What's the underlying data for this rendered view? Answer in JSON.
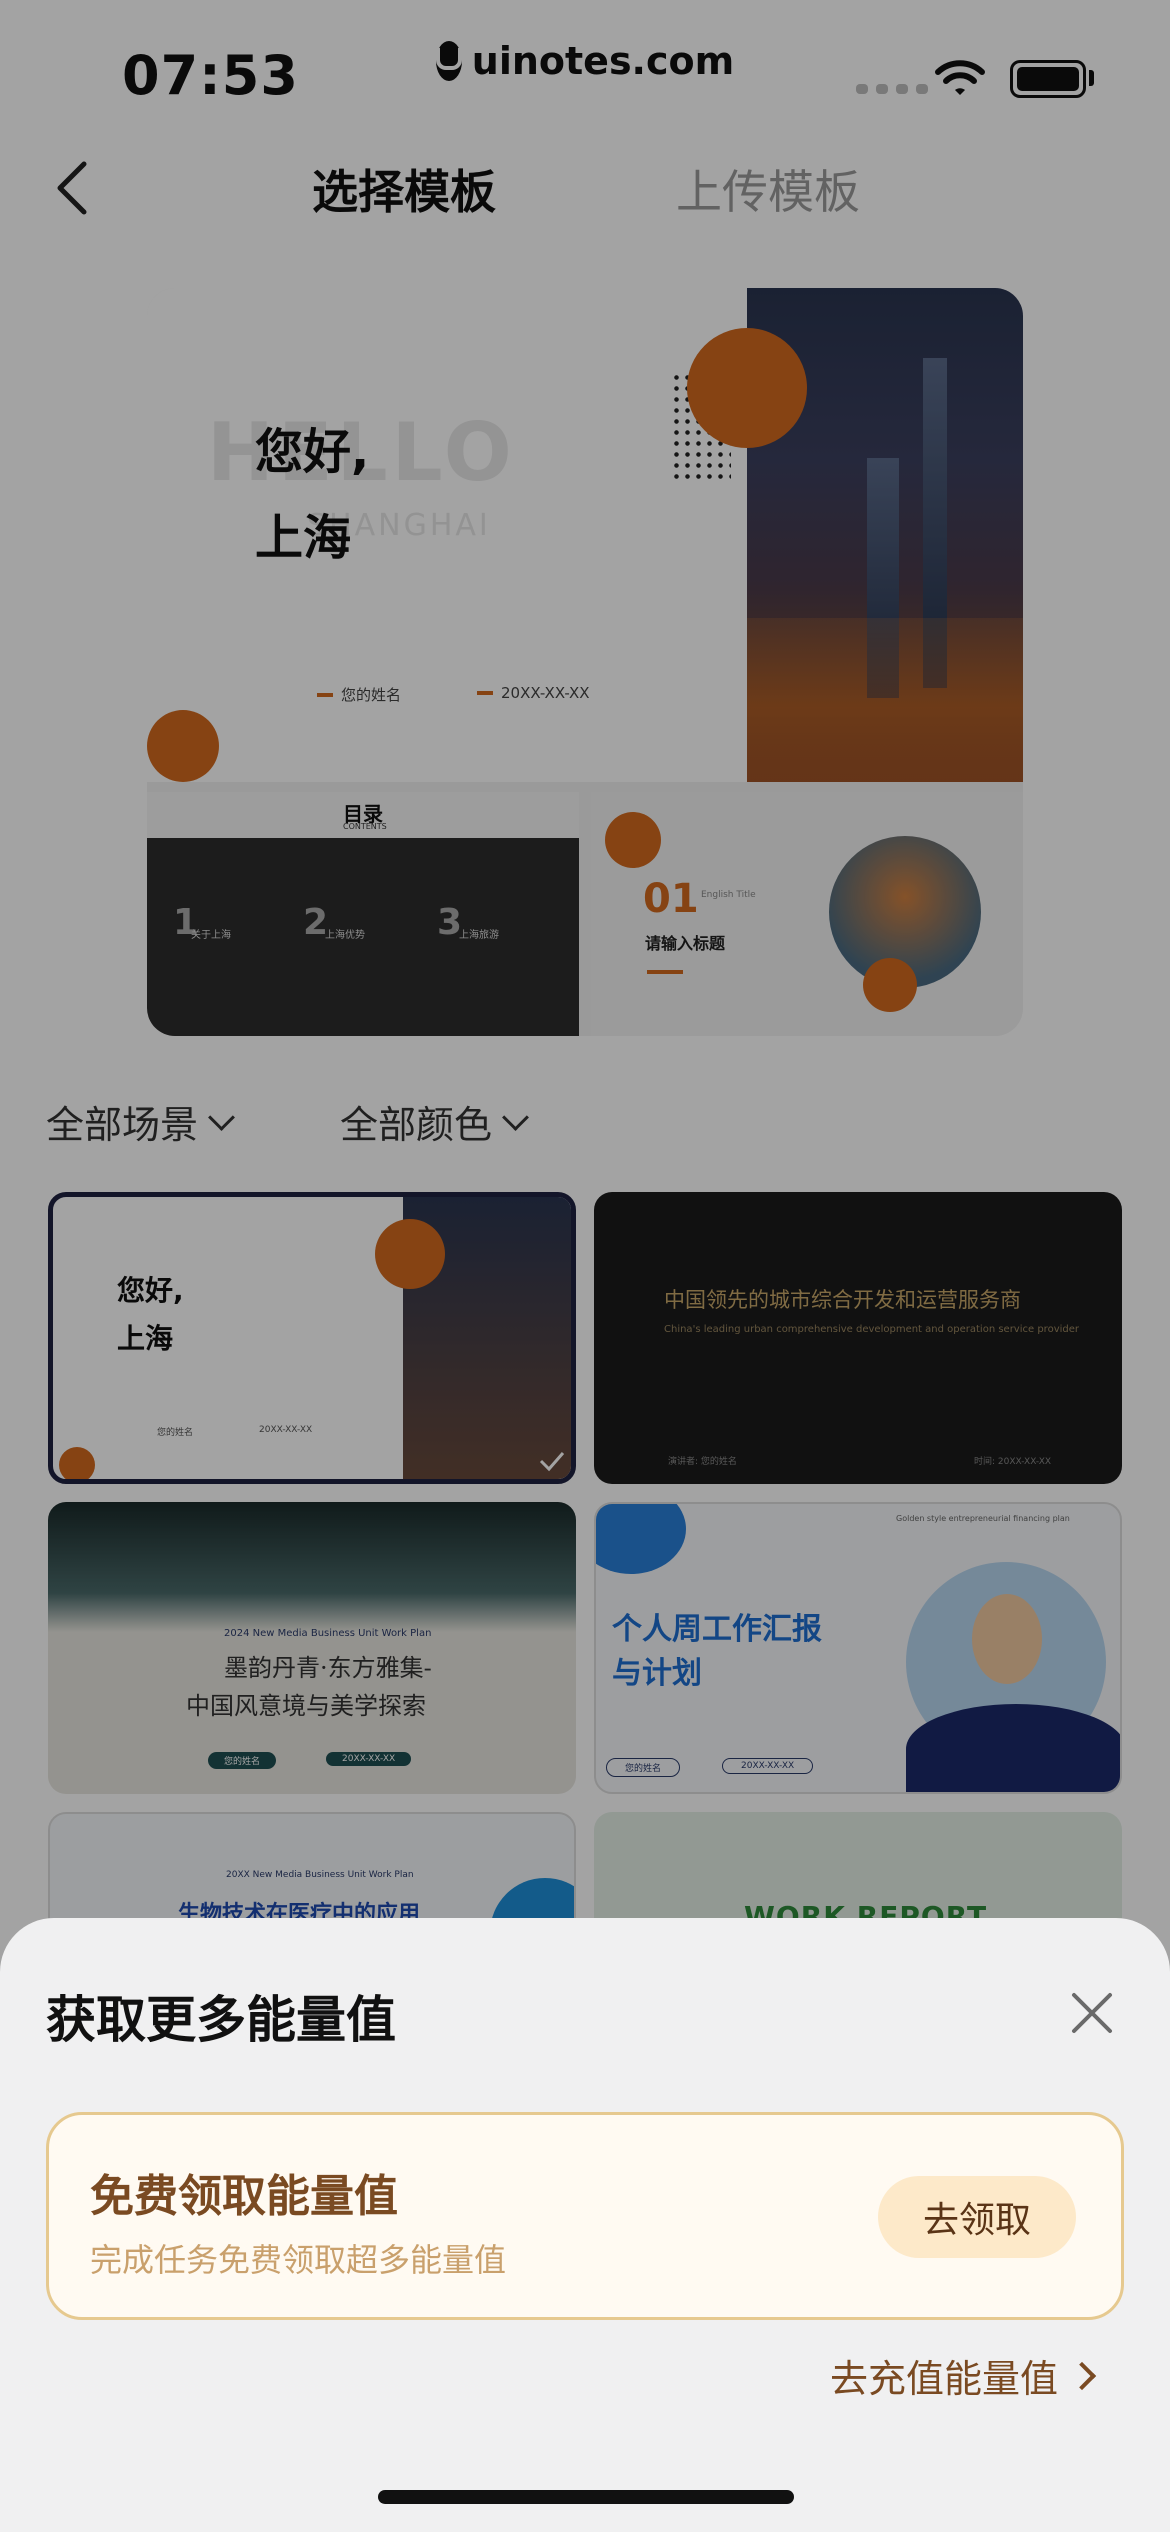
{
  "status_bar": {
    "time": "07:53",
    "site": "uinotes.com"
  },
  "header": {
    "tab_selected": "选择模板",
    "tab_upload": "上传模板"
  },
  "preview": {
    "main": {
      "title_line1": "您好,",
      "title_line2": "上海",
      "bg_word": "HELLO",
      "bg_sub": "SHANGHAI",
      "name": "您的姓名",
      "date": "20XX-XX-XX"
    },
    "toc": {
      "title": "目录",
      "subtitle": "CONTENTS",
      "items": [
        {
          "num": "1",
          "label": "关于上海"
        },
        {
          "num": "2",
          "label": "上海优势"
        },
        {
          "num": "3",
          "label": "上海旅游"
        }
      ]
    },
    "section": {
      "num": "01",
      "en": "English Title",
      "label": "请输入标题"
    }
  },
  "filters": {
    "scene": "全部场景",
    "color": "全部颜色"
  },
  "templates": [
    {
      "title_line1": "您好,",
      "title_line2": "上海",
      "name": "您的姓名",
      "date": "20XX-XX-XX",
      "selected": true
    },
    {
      "title": "中国领先的城市综合开发和运营服务商",
      "subtitle": "China's leading urban comprehensive development and operation service provider",
      "left": "演讲者: 您的姓名",
      "right": "时间: 20XX-XX-XX"
    },
    {
      "en": "2024 New Media Business Unit Work Plan",
      "title_line1": "墨韵丹青·东方雅集-",
      "title_line2": "中国风意境与美学探索",
      "name": "您的姓名",
      "date": "20XX-XX-XX"
    },
    {
      "top": "Golden style entrepreneurial financing plan",
      "title_line1": "个人周工作汇报",
      "title_line2": "与计划",
      "name": "您的姓名",
      "date": "20XX-XX-XX"
    },
    {
      "en": "20XX New Media Business Unit Work Plan",
      "title": "生物技术在医疗中的应用"
    },
    {
      "title": "WORK REPORT"
    }
  ],
  "sheet": {
    "title": "获取更多能量值",
    "promo_title": "免费领取能量值",
    "promo_sub": "完成任务免费领取超多能量值",
    "promo_button": "去领取",
    "recharge": "去充值能量值"
  },
  "colors": {
    "accent": "#d2691e",
    "brown": "#7a4a22",
    "gold_border": "#e6c98f"
  }
}
